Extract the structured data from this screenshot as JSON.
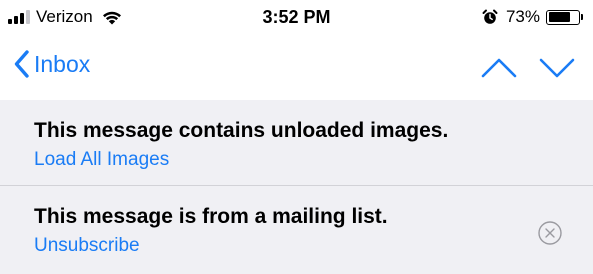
{
  "status_bar": {
    "carrier": "Verizon",
    "time": "3:52 PM",
    "battery": "73%",
    "battery_level": 0.73,
    "icons": [
      "signal-icon",
      "wifi-icon",
      "alarm-icon",
      "battery-icon"
    ]
  },
  "nav": {
    "back_label": "Inbox",
    "icons": [
      "chevron-left-icon",
      "chevron-up-icon",
      "chevron-down-icon"
    ],
    "accent_color": "#1a7cf5"
  },
  "banners": [
    {
      "title": "This message contains unloaded images.",
      "action": "Load All Images"
    },
    {
      "title": "This message is from a mailing list.",
      "action": "Unsubscribe",
      "dismiss_icon": "close-circle-icon"
    }
  ]
}
